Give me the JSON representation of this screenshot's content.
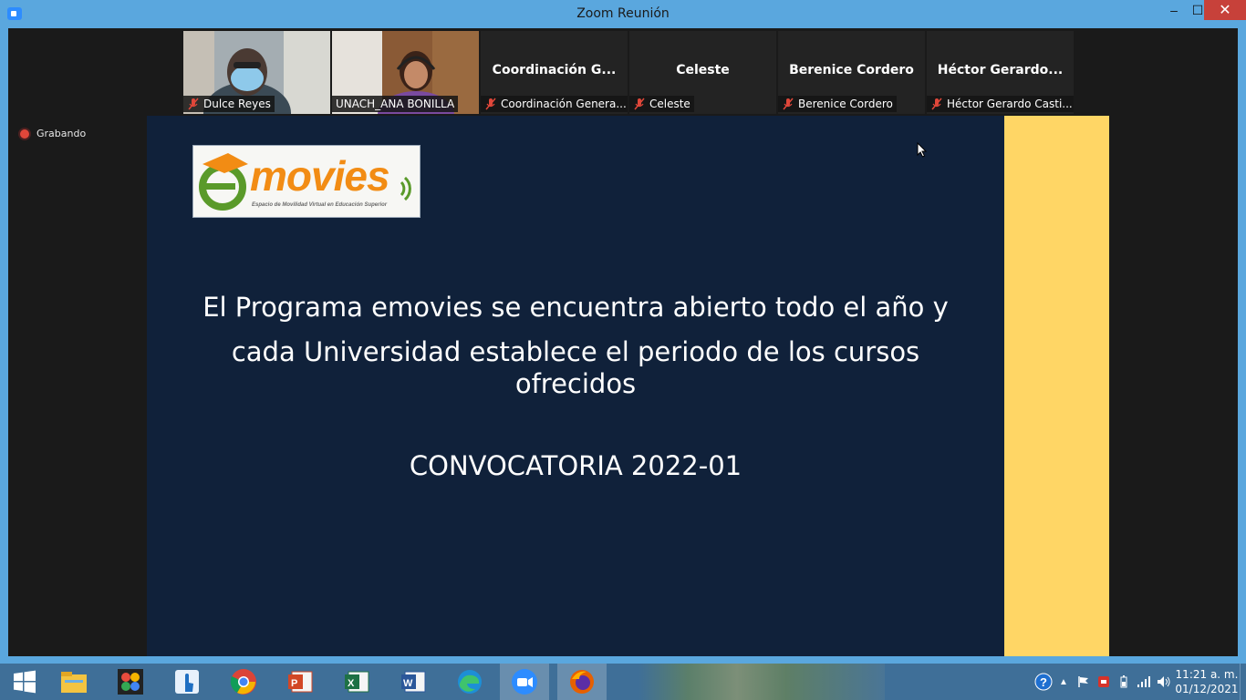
{
  "window": {
    "title": "Zoom Reunión",
    "minimize": "–",
    "maximize": "☐",
    "close": "✕"
  },
  "participants": [
    {
      "big_name": "",
      "label": "Dulce Reyes",
      "video": true,
      "active": false
    },
    {
      "big_name": "",
      "label": "UNACH_ANA BONILLA",
      "video": true,
      "active": true
    },
    {
      "big_name": "Coordinación G...",
      "label": "Coordinación Genera...",
      "video": false,
      "active": false
    },
    {
      "big_name": "Celeste",
      "label": "Celeste",
      "video": false,
      "active": false
    },
    {
      "big_name": "Berenice Cordero",
      "label": "Berenice Cordero",
      "video": false,
      "active": false
    },
    {
      "big_name": "Héctor Gerardo...",
      "label": "Héctor Gerardo Casti...",
      "video": false,
      "active": false
    }
  ],
  "recording": {
    "label": "Grabando"
  },
  "slide": {
    "logo_text": "movies",
    "logo_letter": "e",
    "logo_tagline": "Espacio de Movilidad Virtual en Educación Superior",
    "line1": "El Programa emovies se encuentra abierto todo el año y",
    "line2": "cada Universidad establece el periodo de los cursos",
    "line3": "ofrecidos",
    "heading": "CONVOCATORIA 2022-01",
    "stripe_color": "#ffd665",
    "background_color": "#10213a"
  },
  "taskbar": {
    "apps": [
      {
        "name": "start-icon",
        "active": false
      },
      {
        "name": "file-explorer-icon",
        "active": false
      },
      {
        "name": "photos-app-icon",
        "active": false
      },
      {
        "name": "touch-app-icon",
        "active": false
      },
      {
        "name": "chrome-icon",
        "active": false
      },
      {
        "name": "powerpoint-icon",
        "active": false
      },
      {
        "name": "excel-icon",
        "active": false
      },
      {
        "name": "word-icon",
        "active": false
      },
      {
        "name": "edge-icon",
        "active": false
      },
      {
        "name": "zoom-icon",
        "active": true
      },
      {
        "name": "firefox-icon",
        "active": true
      }
    ],
    "time": "11:21 a. m.",
    "date": "01/12/2021"
  }
}
